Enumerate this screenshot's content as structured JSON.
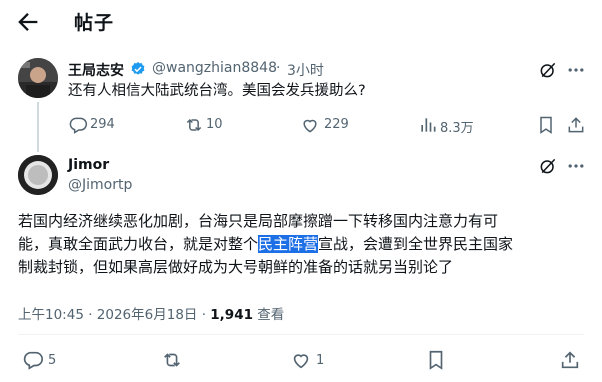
{
  "header": {
    "title": "帖子"
  },
  "quoted": {
    "name": "王局志安",
    "handle": "@wangzhian8848",
    "separator": "·",
    "time": "3小时",
    "text": "还有人相信大陆武统台湾。美国会发兵援助么?",
    "replies": "294",
    "reposts": "10",
    "likes": "229",
    "views": "8.3万"
  },
  "reply": {
    "name": "Jimor",
    "handle": "@Jimortp",
    "line1": "若国内经济继续恶化加剧，台海只是局部摩擦蹭一下转移国内注意力有可",
    "line2_before": "能，真敢全面武力收台，就是对整个",
    "line2_highlight": "民主阵营",
    "line2_after": "宣战，会遭到全世界民主国家",
    "line3": "制裁封锁，但如果高层做好成为大号朝鲜的准备的话就另当别论了",
    "timestamp": "上午10:45 · 2026年6月18日 · ",
    "views_count": "1,941",
    "views_label": " 查看",
    "replies": "5",
    "likes": "1"
  },
  "colors": {
    "verified": "#1d9bf0",
    "highlight": "#1d6fe6",
    "muted": "#536471"
  }
}
